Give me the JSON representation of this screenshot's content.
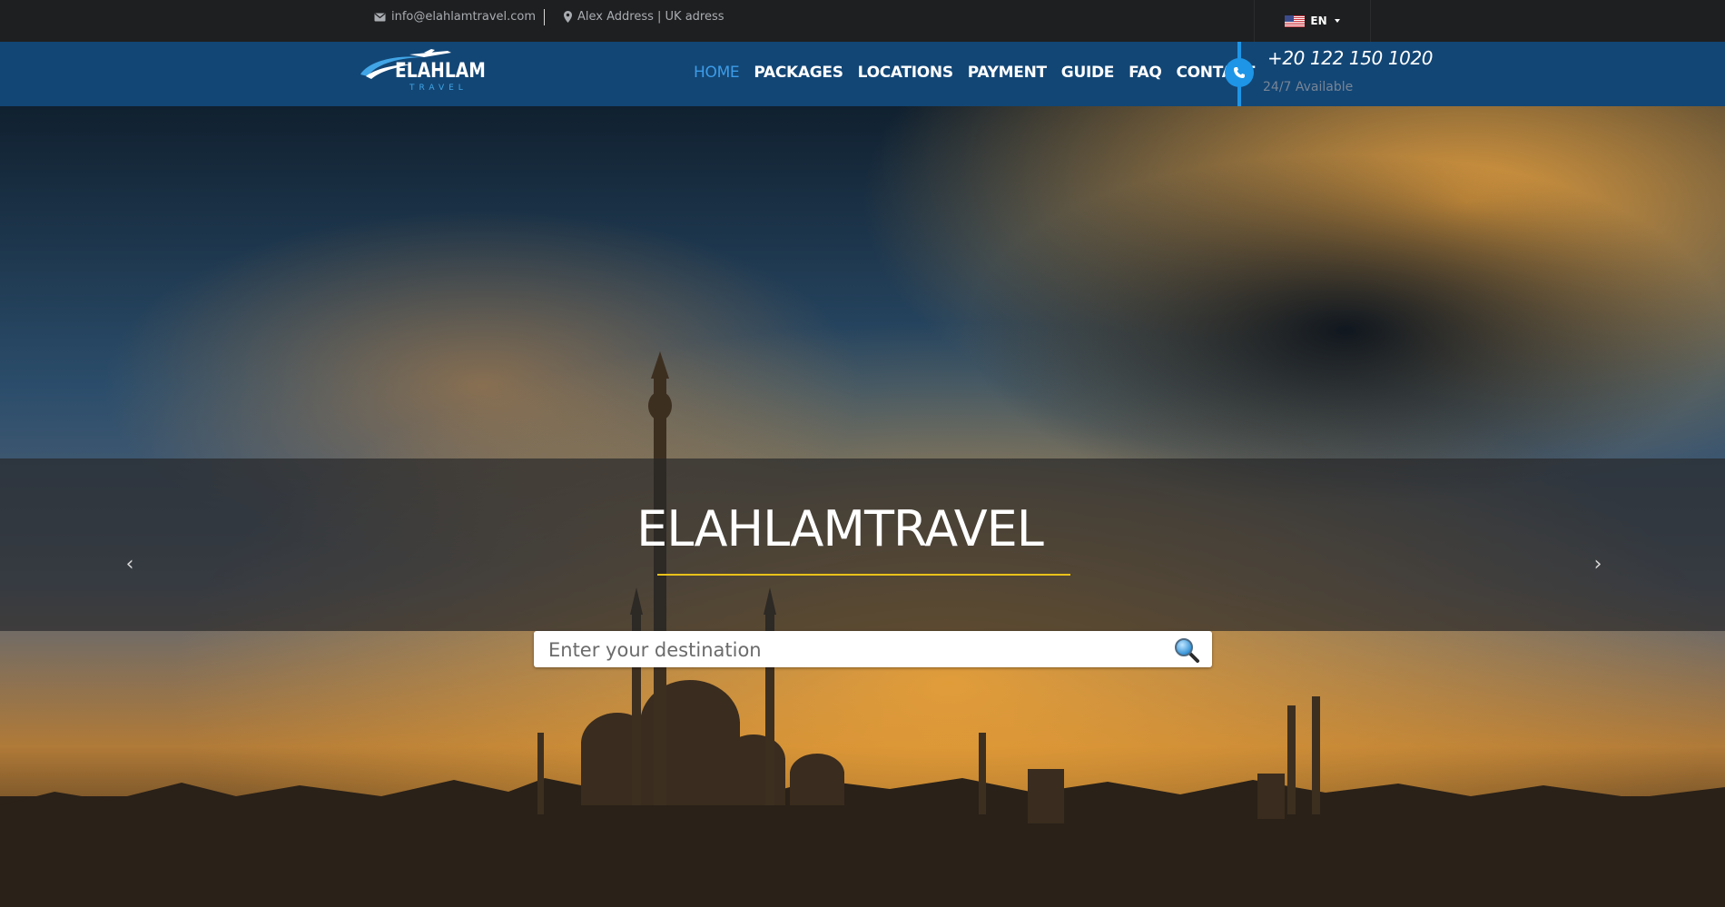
{
  "topbar": {
    "email": "info@elahlamtravel.com",
    "address": "Alex Address | UK adress",
    "language": "EN"
  },
  "brand": {
    "name": "ELAHLAM",
    "subtitle": "TRAVEL"
  },
  "nav": {
    "items": [
      {
        "label": "HOME",
        "active": true
      },
      {
        "label": "PACKAGES",
        "active": false
      },
      {
        "label": "LOCATIONS",
        "active": false
      },
      {
        "label": "PAYMENT",
        "active": false
      },
      {
        "label": "GUIDE",
        "active": false
      },
      {
        "label": "FAQ",
        "active": false
      },
      {
        "label": "CONTACT",
        "active": false
      }
    ],
    "phone": "+20 122 150 1020",
    "availability": "24/7 Available"
  },
  "hero": {
    "title": "ELAHLAMTRAVEL",
    "search_placeholder": "Enter your destination",
    "prev_arrow": "‹",
    "next_arrow": "›"
  },
  "colors": {
    "navbar": "#124675",
    "topbar": "#1e1f21",
    "accent": "#1e95e6",
    "active_link": "#3c9ce8",
    "title_underline": "#e9c21a"
  }
}
